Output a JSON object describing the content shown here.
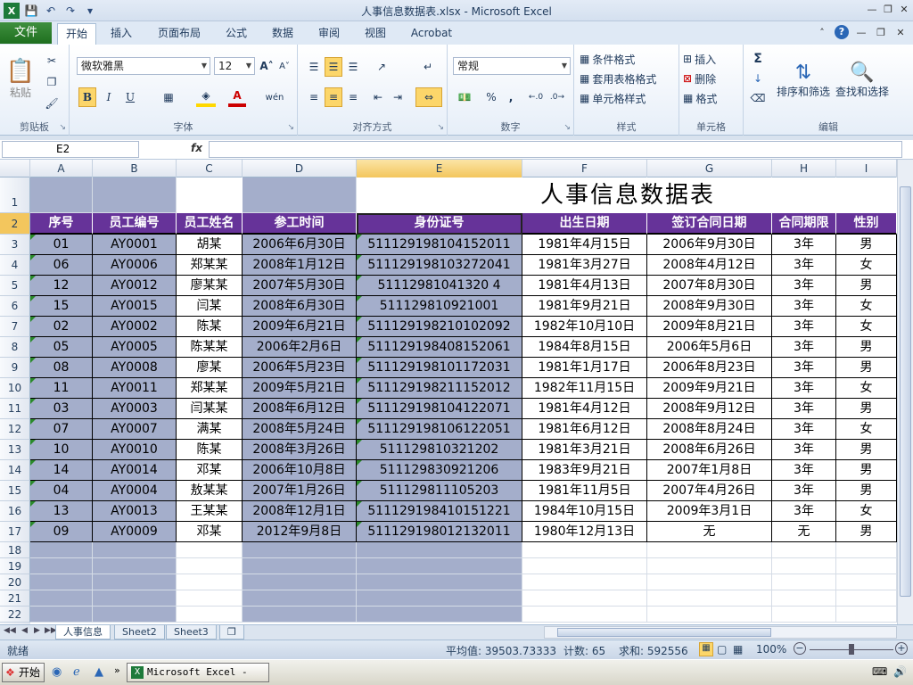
{
  "window": {
    "title": "人事信息数据表.xlsx - Microsoft Excel"
  },
  "qat": {
    "icon_app": "excel-icon",
    "save": "save-icon",
    "undo": "undo-icon",
    "redo": "redo-icon",
    "customize": "customize-icon"
  },
  "tabs": {
    "file": "文件",
    "items": [
      "开始",
      "插入",
      "页面布局",
      "公式",
      "数据",
      "审阅",
      "视图",
      "Acrobat"
    ]
  },
  "ribbon": {
    "clipboard": {
      "label": "剪贴板",
      "paste": "粘贴"
    },
    "font": {
      "label": "字体",
      "name": "微软雅黑",
      "size": "12",
      "bold": "B",
      "italic": "I",
      "underline": "U"
    },
    "align": {
      "label": "对齐方式"
    },
    "number": {
      "label": "数字",
      "format": "常规",
      "percent": "%",
      "comma": ","
    },
    "styles": {
      "label": "样式",
      "cond": "条件格式",
      "table": "套用表格格式",
      "cell": "单元格样式"
    },
    "cells": {
      "label": "单元格",
      "insert": "插入",
      "delete": "删除",
      "format": "格式"
    },
    "edit": {
      "label": "编辑",
      "sort": "排序和筛选",
      "find": "查找和选择",
      "sigma": "Σ"
    }
  },
  "formula_bar": {
    "name_box": "E2",
    "fx": "fx",
    "value": ""
  },
  "columns": [
    "A",
    "B",
    "C",
    "D",
    "E",
    "F",
    "G",
    "H",
    "I"
  ],
  "rows": [
    "1",
    "2",
    "3",
    "4",
    "5",
    "6",
    "7",
    "8",
    "9",
    "10",
    "11",
    "12",
    "13",
    "14",
    "15",
    "16",
    "17",
    "18",
    "19",
    "20",
    "21",
    "22"
  ],
  "sheet": {
    "title": "人事信息数据表",
    "headers": [
      "序号",
      "员工编号",
      "员工姓名",
      "参工时间",
      "身份证号",
      "出生日期",
      "签订合同日期",
      "合同期限",
      "性别"
    ],
    "data": [
      [
        "01",
        "AY0001",
        "胡某",
        "2006年6月30日",
        "511129198104152011",
        "1981年4月15日",
        "2006年9月30日",
        "3年",
        "男"
      ],
      [
        "06",
        "AY0006",
        "郑某某",
        "2008年1月12日",
        "511129198103272041",
        "1981年3月27日",
        "2008年4月12日",
        "3年",
        "女"
      ],
      [
        "12",
        "AY0012",
        "廖某某",
        "2007年5月30日",
        "51112981041320 4",
        "1981年4月13日",
        "2007年8月30日",
        "3年",
        "男"
      ],
      [
        "15",
        "AY0015",
        "闫某",
        "2008年6月30日",
        "511129810921001",
        "1981年9月21日",
        "2008年9月30日",
        "3年",
        "女"
      ],
      [
        "02",
        "AY0002",
        "陈某",
        "2009年6月21日",
        "511129198210102092",
        "1982年10月10日",
        "2009年8月21日",
        "3年",
        "女"
      ],
      [
        "05",
        "AY0005",
        "陈某某",
        "2006年2月6日",
        "511129198408152061",
        "1984年8月15日",
        "2006年5月6日",
        "3年",
        "男"
      ],
      [
        "08",
        "AY0008",
        "廖某",
        "2006年5月23日",
        "511129198101172031",
        "1981年1月17日",
        "2006年8月23日",
        "3年",
        "男"
      ],
      [
        "11",
        "AY0011",
        "郑某某",
        "2009年5月21日",
        "511129198211152012",
        "1982年11月15日",
        "2009年9月21日",
        "3年",
        "女"
      ],
      [
        "03",
        "AY0003",
        "闫某某",
        "2008年6月12日",
        "511129198104122071",
        "1981年4月12日",
        "2008年9月12日",
        "3年",
        "男"
      ],
      [
        "07",
        "AY0007",
        "满某",
        "2008年5月24日",
        "511129198106122051",
        "1981年6月12日",
        "2008年8月24日",
        "3年",
        "女"
      ],
      [
        "10",
        "AY0010",
        "陈某",
        "2008年3月26日",
        "511129810321202",
        "1981年3月21日",
        "2008年6月26日",
        "3年",
        "男"
      ],
      [
        "14",
        "AY0014",
        "邓某",
        "2006年10月8日",
        "511129830921206",
        "1983年9月21日",
        "2007年1月8日",
        "3年",
        "男"
      ],
      [
        "04",
        "AY0004",
        "敖某某",
        "2007年1月26日",
        "511129811105203",
        "1981年11月5日",
        "2007年4月26日",
        "3年",
        "男"
      ],
      [
        "13",
        "AY0013",
        "王某某",
        "2008年12月1日",
        "511129198410151221",
        "1984年10月15日",
        "2009年3月1日",
        "3年",
        "女"
      ],
      [
        "09",
        "AY0009",
        "邓某",
        "2012年9月8日",
        "511129198012132011",
        "1980年12月13日",
        "无",
        "无",
        "男"
      ]
    ]
  },
  "sheet_tabs": [
    "人事信息",
    "Sheet2",
    "Sheet3"
  ],
  "status": {
    "ready": "就绪",
    "avg": "平均值: 39503.73333",
    "count": "计数: 65",
    "sum": "求和: 592556",
    "zoom": "100%"
  },
  "taskbar": {
    "start": "开始",
    "item": "Microsoft Excel - ..."
  }
}
